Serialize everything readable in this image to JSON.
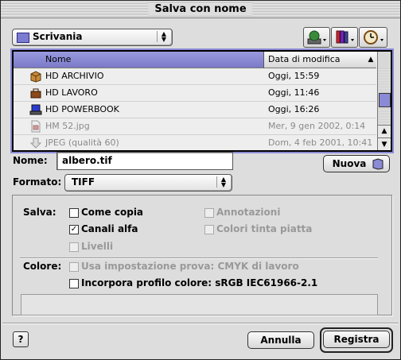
{
  "window": {
    "title": "Salva con nome"
  },
  "location": {
    "selected": "Scrivania"
  },
  "toolbar": {
    "network_icon": "globe-disk-icon",
    "favorites_icon": "books-icon",
    "recent_icon": "clock-icon"
  },
  "file_list": {
    "columns": {
      "name": "Nome",
      "date": "Data di modifica"
    },
    "rows": [
      {
        "name": "HD ARCHIVIO",
        "date": "Oggi, 15:59",
        "icon": "box-disk-icon",
        "enabled": true
      },
      {
        "name": "HD LAVORO",
        "date": "Oggi, 11:46",
        "icon": "toolbox-disk-icon",
        "enabled": true
      },
      {
        "name": "HD POWERBOOK",
        "date": "Oggi, 16:26",
        "icon": "laptop-disk-icon",
        "enabled": true
      },
      {
        "name": "HM 52.jpg",
        "date": "Mer, 9 gen 2002, 0:14",
        "icon": "document-icon",
        "enabled": false
      },
      {
        "name": "JPEG (qualità 60)",
        "date": "Dom, 4 feb 2001, 10:41",
        "icon": "alias-arrow-icon",
        "enabled": false
      }
    ]
  },
  "name_field": {
    "label": "Nome:",
    "value": "albero.tif"
  },
  "new_folder_button": {
    "label": "Nuova"
  },
  "format": {
    "label": "Formato:",
    "value": "TIFF"
  },
  "save_options": {
    "label": "Salva:",
    "as_copy": {
      "label": "Come copia",
      "checked": false,
      "enabled": true
    },
    "annotations": {
      "label": "Annotazioni",
      "checked": false,
      "enabled": false
    },
    "alpha_channels": {
      "label": "Canali alfa",
      "checked": true,
      "enabled": true
    },
    "spot_colors": {
      "label": "Colori tinta piatta",
      "checked": false,
      "enabled": false
    },
    "layers": {
      "label": "Livelli",
      "checked": false,
      "enabled": false
    }
  },
  "color_options": {
    "label": "Colore:",
    "use_proof": {
      "label": "Usa impostazione prova:",
      "value": "CMYK di lavoro",
      "checked": false,
      "enabled": false
    },
    "embed_profile": {
      "label": "Incorpora profilo colore:",
      "value": "sRGB IEC61966-2.1",
      "checked": false,
      "enabled": true
    }
  },
  "footer": {
    "help": "?",
    "cancel": "Annulla",
    "save": "Registra"
  }
}
